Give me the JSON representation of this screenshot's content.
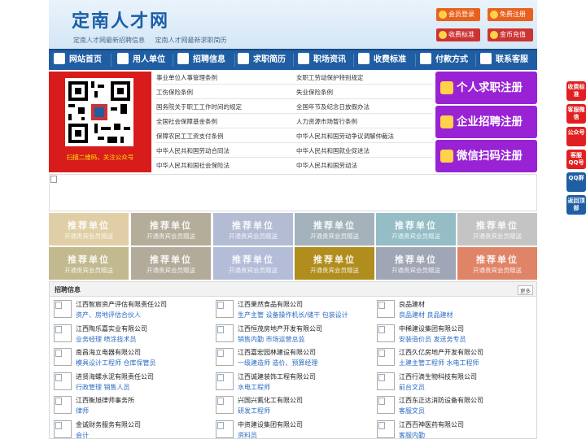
{
  "header": {
    "title": "定南人才网",
    "taglines": [
      "定南人才网最新招聘信息",
      "定南人才网最新求职简历"
    ],
    "buttons": {
      "login": "会员登录",
      "register": "免费注册",
      "fee": "收费标准",
      "coin": "金币充值"
    }
  },
  "nav": [
    "网站首页",
    "用人单位",
    "招聘信息",
    "求职简历",
    "职场资讯",
    "收费标准",
    "付款方式",
    "联系客服"
  ],
  "qr_caption": "扫描二维码，关注公众号",
  "laws": [
    [
      "事业单位人事管理条例",
      "女职工劳动保护特别规定"
    ],
    [
      "工伤保险条例",
      "失业保险条例"
    ],
    [
      "国务院关于职工工作时间的规定",
      "全国年节及纪念日放假办法"
    ],
    [
      "全国社会保障基金条例",
      "人力资源市场暂行条例"
    ],
    [
      "保障农民工工资支付条例",
      "中华人民共和国劳动争议调解仲裁法"
    ],
    [
      "中华人民共和国劳动合同法",
      "中华人民共和国就业促进法"
    ],
    [
      "中华人民共和国社会保险法",
      "中华人民共和国劳动法"
    ]
  ],
  "register": [
    "个人求职注册",
    "企业招聘注册",
    "微信扫码注册"
  ],
  "recommend": {
    "title": "推荐单位",
    "subtitle": "开通贵宾会员赠送",
    "colors": [
      "#e0cfa6",
      "#b4ad9a",
      "#b4bcd4",
      "#a4b3bb",
      "#94bdc6",
      "#c4c4c4",
      "#c2b98e",
      "#b3ab9a",
      "#b4bdd8",
      "#b08d1c",
      "#a0a6b6",
      "#e08468"
    ]
  },
  "jobs": {
    "title": "招聘信息",
    "more": "更多",
    "items": [
      {
        "company": "江西智宸资产评估有限责任公司",
        "positions": "资产、房地评估合伙人"
      },
      {
        "company": "江西果然食品有限公司",
        "positions": "生产主管  设备操作机长/储干  包装设计"
      },
      {
        "company": "良品建材",
        "positions": "良品建材  良品建材"
      },
      {
        "company": "江西陶乐嘉实业有限公司",
        "positions": "业务经理  喷涂技术员"
      },
      {
        "company": "江西恒茂房地产开发有限公司",
        "positions": "销售内勤  市场运营总监"
      },
      {
        "company": "中稀建设集团有限公司",
        "positions": "安装造价员  发送务专员"
      },
      {
        "company": "南昌海立电器有限公司",
        "positions": "模具设计工程师  仓库保管员"
      },
      {
        "company": "江西嘉宏园林建设有限公司",
        "positions": "一级建造师  造价、预算经理"
      },
      {
        "company": "江西久亿房地产开发有限公司",
        "positions": "土建主管工程师  水电工程师"
      },
      {
        "company": "进贤海螺水泥有限责任公司",
        "positions": "行政管理  销售人员"
      },
      {
        "company": "江西诚建装饰工程有限公司",
        "positions": "水电工程师"
      },
      {
        "company": "江西行滴生物科技有限公司",
        "positions": "前台文员"
      },
      {
        "company": "江西衡旭律师事务所",
        "positions": "律师"
      },
      {
        "company": "兴国兴氟化工有限公司",
        "positions": "研发工程师"
      },
      {
        "company": "江西东正达消防设备有限公司",
        "positions": "客服文员"
      },
      {
        "company": "金诚财务服务有限公司",
        "positions": "会计"
      },
      {
        "company": "中资建设集团有限公司",
        "positions": "资料员"
      },
      {
        "company": "江西百神医药有限公司",
        "positions": "客服内勤"
      }
    ]
  },
  "float_bar": [
    {
      "label": "收费标准",
      "color": "#e02020"
    },
    {
      "label": "客服微信",
      "color": "#e02020"
    },
    {
      "label": "公众号",
      "color": "#e02020"
    },
    {
      "label": "客服QQ号",
      "color": "#e02020"
    },
    {
      "label": "QQ群",
      "color": "#1f5ea3"
    },
    {
      "label": "返回顶部",
      "color": "#1f5ea3"
    }
  ]
}
